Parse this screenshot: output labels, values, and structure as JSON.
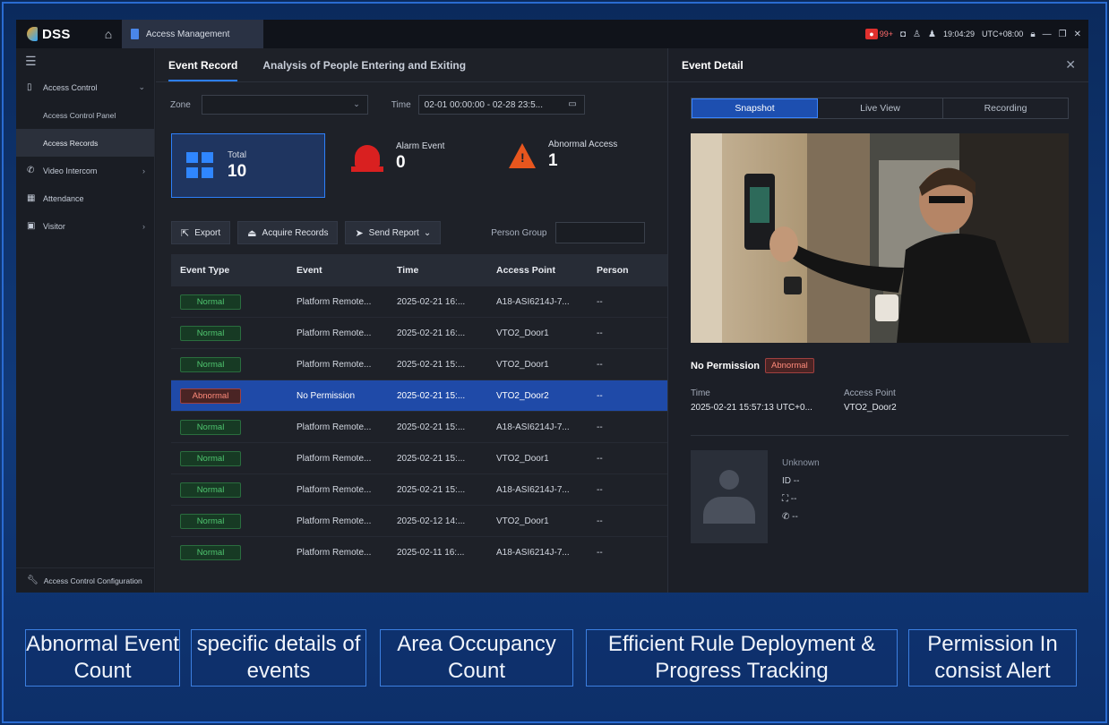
{
  "app": {
    "logo": "DSS",
    "tab_label": "Access Management",
    "notif_count": "99+",
    "clock": "19:04:29",
    "timezone": "UTC+08:00"
  },
  "sidebar": {
    "items": [
      {
        "label": "Access Control",
        "icon": "door-icon"
      },
      {
        "label": "Access Control Panel"
      },
      {
        "label": "Access Records"
      },
      {
        "label": "Video Intercom",
        "icon": "phone-icon"
      },
      {
        "label": "Attendance",
        "icon": "grid-icon"
      },
      {
        "label": "Visitor",
        "icon": "visitor-icon"
      }
    ],
    "bottom": "Access Control Configuration"
  },
  "main": {
    "tabs": [
      "Event Record",
      "Analysis of People Entering and Exiting"
    ],
    "filters": {
      "zone_label": "Zone",
      "time_label": "Time",
      "time_value": "02-01 00:00:00 - 02-28 23:5..."
    },
    "stats": {
      "total_label": "Total",
      "total_value": "10",
      "alarm_label": "Alarm Event",
      "alarm_value": "0",
      "abnormal_label": "Abnormal Access",
      "abnormal_value": "1"
    },
    "toolbar": {
      "export": "Export",
      "acquire": "Acquire Records",
      "send_report": "Send Report",
      "person_group": "Person Group"
    },
    "table": {
      "headers": [
        "Event Type",
        "Event",
        "Time",
        "Access Point",
        "Person"
      ],
      "rows": [
        [
          "Normal",
          "Platform Remote...",
          "2025-02-21 16:...",
          "A18-ASI6214J-7...",
          "--"
        ],
        [
          "Normal",
          "Platform Remote...",
          "2025-02-21 16:...",
          "VTO2_Door1",
          "--"
        ],
        [
          "Normal",
          "Platform Remote...",
          "2025-02-21 15:...",
          "VTO2_Door1",
          "--"
        ],
        [
          "Abnormal",
          "No Permission",
          "2025-02-21 15:...",
          "VTO2_Door2",
          "--"
        ],
        [
          "Normal",
          "Platform Remote...",
          "2025-02-21 15:...",
          "A18-ASI6214J-7...",
          "--"
        ],
        [
          "Normal",
          "Platform Remote...",
          "2025-02-21 15:...",
          "VTO2_Door1",
          "--"
        ],
        [
          "Normal",
          "Platform Remote...",
          "2025-02-21 15:...",
          "A18-ASI6214J-7...",
          "--"
        ],
        [
          "Normal",
          "Platform Remote...",
          "2025-02-12 14:...",
          "VTO2_Door1",
          "--"
        ],
        [
          "Normal",
          "Platform Remote...",
          "2025-02-11 16:...",
          "A18-ASI6214J-7...",
          "--"
        ]
      ]
    }
  },
  "detail": {
    "title": "Event Detail",
    "segments": [
      "Snapshot",
      "Live View",
      "Recording"
    ],
    "event_name": "No Permission",
    "event_tag": "Abnormal",
    "time_label": "Time",
    "time_value": "2025-02-21 15:57:13 UTC+0...",
    "ap_label": "Access Point",
    "ap_value": "VTO2_Door2",
    "person_name": "Unknown",
    "person_id": "ID --",
    "person_dept": "--",
    "person_phone": "--"
  },
  "captions": [
    "Abnormal Event Count",
    "specific details of events",
    "Area Occupancy Count",
    "Efficient Rule Deployment & Progress Tracking",
    "Permission In consist Alert"
  ],
  "colors": {
    "accent": "#2d7ff9",
    "normal_tag": "#4fc56f",
    "abnormal_tag": "#ff8b7b",
    "alarm": "#d92020",
    "warning": "#e8561e"
  }
}
